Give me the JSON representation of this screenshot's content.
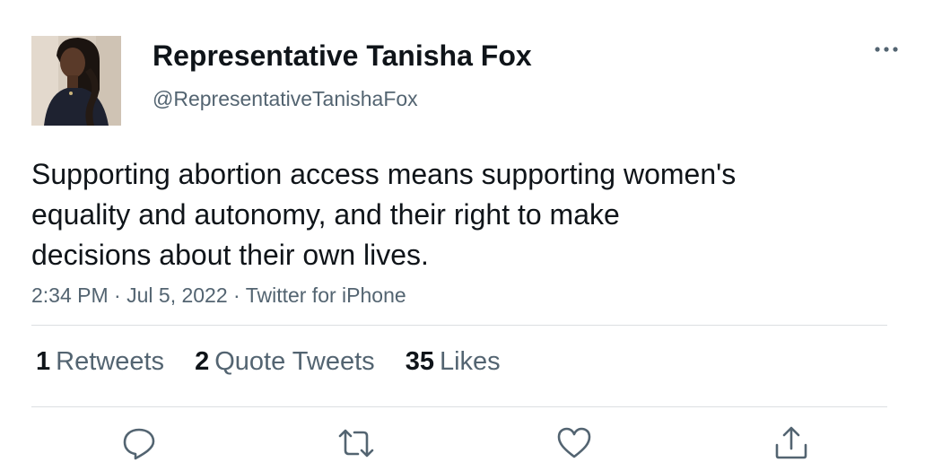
{
  "author": {
    "display_name": "Representative Tanisha Fox",
    "handle": "@RepresentativeTanishaFox"
  },
  "tweet": {
    "text_lines": [
      "Supporting abortion access means supporting women's",
      "equality and autonomy, and their right to make",
      "decisions about their own lives."
    ],
    "time": "2:34 PM",
    "separator": "·",
    "date": "Jul 5, 2022",
    "source": "Twitter for iPhone"
  },
  "stats": {
    "retweets": {
      "count": "1",
      "label": "Retweets"
    },
    "quotes": {
      "count": "2",
      "label": "Quote Tweets"
    },
    "likes": {
      "count": "35",
      "label": "Likes"
    }
  },
  "icons": {
    "more": "more-horizontal-icon",
    "reply": "reply-icon",
    "retweet": "retweet-icon",
    "like": "heart-icon",
    "share": "share-icon"
  },
  "colors": {
    "text_primary": "#0f1419",
    "text_secondary": "#536471",
    "divider": "#dcdfe2"
  }
}
